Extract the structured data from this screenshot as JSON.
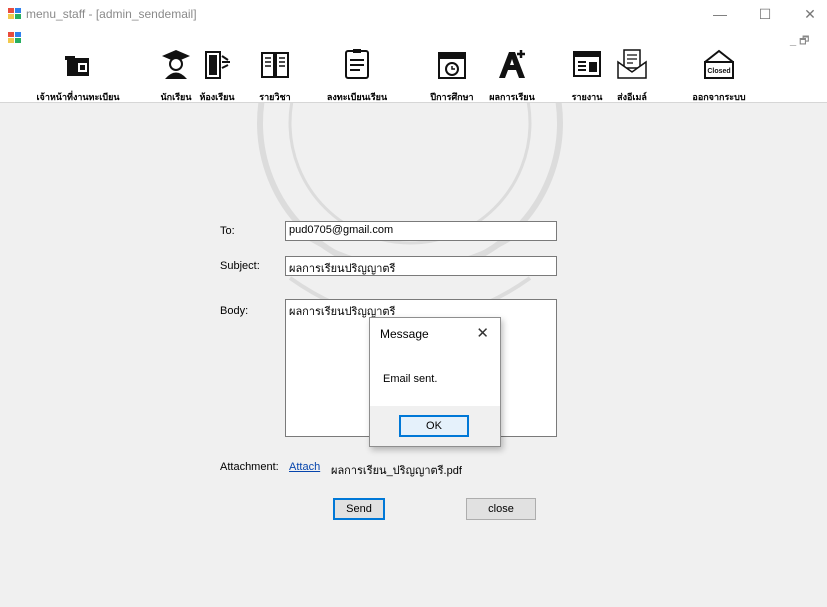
{
  "window": {
    "title": "menu_staff - [admin_sendemail]",
    "minimize": "—",
    "maximize": "☐",
    "close": "✕",
    "mdi_controls": "_ 🗗"
  },
  "toolbar": {
    "items": [
      {
        "label": "เจ้าหน้าที่งานทะเบียน",
        "icon": "staff-icon"
      },
      {
        "label": "นักเรียน",
        "icon": "graduate-icon"
      },
      {
        "label": "ห้องเรียน",
        "icon": "classroom-icon"
      },
      {
        "label": "รายวิชา",
        "icon": "book-icon"
      },
      {
        "label": "ลงทะเบียนเรียน",
        "icon": "register-icon"
      },
      {
        "label": "ปีการศึกษา",
        "icon": "calendar-icon"
      },
      {
        "label": "ผลการเรียน",
        "icon": "grade-icon"
      },
      {
        "label": "รายงาน",
        "icon": "report-icon"
      },
      {
        "label": "ส่งอีเมล์",
        "icon": "mail-icon"
      },
      {
        "label": "ออกจากระบบ",
        "icon": "logout-icon"
      }
    ]
  },
  "form": {
    "to_label": "To:",
    "to_value": "pud0705@gmail.com",
    "subject_label": "Subject:",
    "subject_value": "ผลการเรียนปริญญาตรี",
    "body_label": "Body:",
    "body_value": "ผลการเรียนปริญญาตรี",
    "attachment_label": "Attachment:",
    "attach_link": "Attach",
    "attachment_file": "ผลการเรียน_ปริญญาตรี.pdf",
    "send_button": "Send",
    "close_button": "close"
  },
  "message_box": {
    "title": "Message",
    "close": "✕",
    "text": "Email sent.",
    "ok_button": "OK"
  },
  "colors": {
    "accent": "#0078d7",
    "link": "#0645ad"
  }
}
